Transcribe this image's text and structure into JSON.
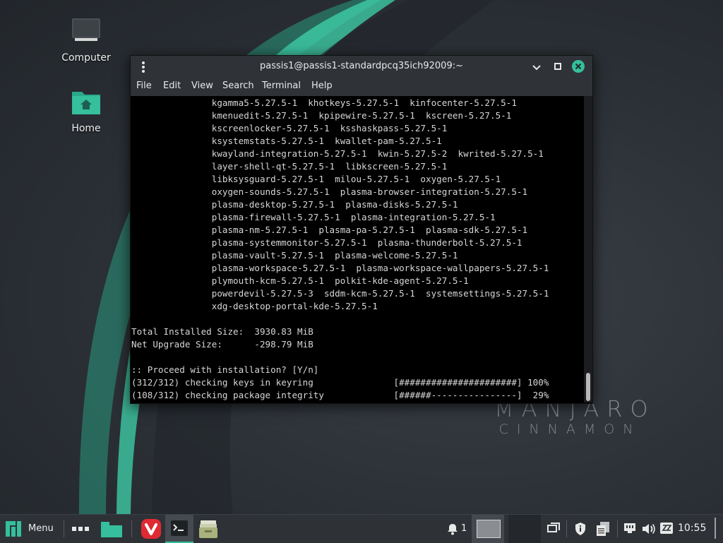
{
  "desktop": {
    "icons": [
      {
        "label": "Computer"
      },
      {
        "label": "Home"
      }
    ],
    "watermark": {
      "line1": "MANJARO",
      "line2": "CINNAMON"
    },
    "accent": "#35bf9c"
  },
  "window": {
    "title": "passis1@passis1-standardpcq35ich92009:~",
    "menu": [
      "File",
      "Edit",
      "View",
      "Search",
      "Terminal",
      "Help"
    ],
    "buttons": {
      "minimize": "minimize-icon",
      "maximize": "maximize-icon",
      "close": "close-icon"
    },
    "close_color": "#35bf9c",
    "terminal_lines": [
      "               kgamma5-5.27.5-1  khotkeys-5.27.5-1  kinfocenter-5.27.5-1",
      "               kmenuedit-5.27.5-1  kpipewire-5.27.5-1  kscreen-5.27.5-1",
      "               kscreenlocker-5.27.5-1  ksshaskpass-5.27.5-1",
      "               ksystemstats-5.27.5-1  kwallet-pam-5.27.5-1",
      "               kwayland-integration-5.27.5-1  kwin-5.27.5-2  kwrited-5.27.5-1",
      "               layer-shell-qt-5.27.5-1  libkscreen-5.27.5-1",
      "               libksysguard-5.27.5-1  milou-5.27.5-1  oxygen-5.27.5-1",
      "               oxygen-sounds-5.27.5-1  plasma-browser-integration-5.27.5-1",
      "               plasma-desktop-5.27.5-1  plasma-disks-5.27.5-1",
      "               plasma-firewall-5.27.5-1  plasma-integration-5.27.5-1",
      "               plasma-nm-5.27.5-1  plasma-pa-5.27.5-1  plasma-sdk-5.27.5-1",
      "               plasma-systemmonitor-5.27.5-1  plasma-thunderbolt-5.27.5-1",
      "               plasma-vault-5.27.5-1  plasma-welcome-5.27.5-1",
      "               plasma-workspace-5.27.5-1  plasma-workspace-wallpapers-5.27.5-1",
      "               plymouth-kcm-5.27.5-1  polkit-kde-agent-5.27.5-1",
      "               powerdevil-5.27.5-3  sddm-kcm-5.27.5-1  systemsettings-5.27.5-1",
      "               xdg-desktop-portal-kde-5.27.5-1",
      "",
      "Total Installed Size:  3930.83 MiB",
      "Net Upgrade Size:      -298.79 MiB",
      "",
      ":: Proceed with installation? [Y/n]",
      "(312/312) checking keys in keyring               [######################] 100%",
      "(108/312) checking package integrity             [######----------------]  29%"
    ]
  },
  "taskbar": {
    "menu_label": "Menu",
    "notifications_count": "1",
    "clock": "10:55",
    "launchers": [
      "show-apps-icon",
      "show-desktop-icon",
      "vivaldi-icon",
      "terminal-icon",
      "file-manager-icon"
    ],
    "tray": [
      "notification-bell-icon",
      "window-list-icon",
      "update-shield-icon",
      "clipboard-icon",
      "network-icon",
      "volume-icon",
      "keyboard-icon"
    ]
  }
}
